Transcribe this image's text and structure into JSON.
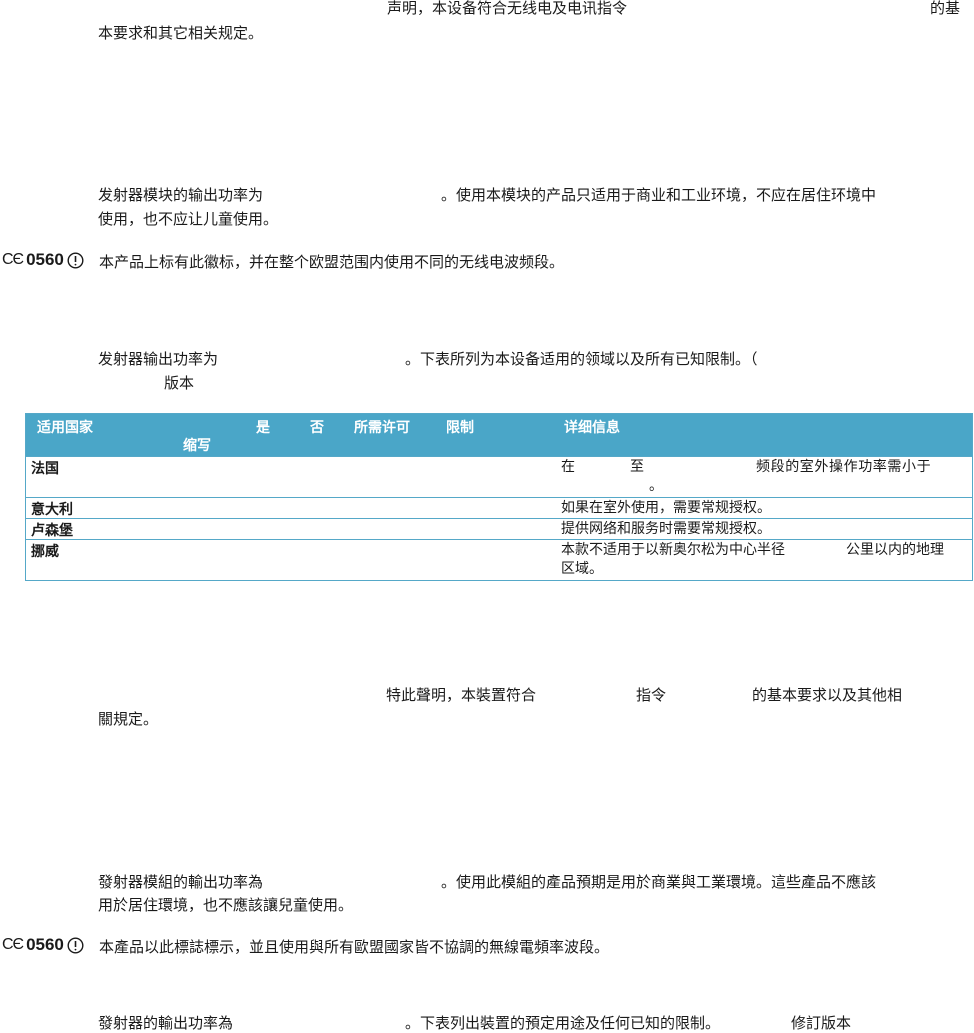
{
  "section_simplified": {
    "declaration_line1_a": "声明，本设备符合无线电及电讯指令",
    "declaration_line1_b": "的基",
    "declaration_line2": "本要求和其它相关规定。",
    "power_line1_a": "发射器模块的输出功率为",
    "power_line1_b": "。使用本模块的产品只适用于商业和工业环境，不应在居住环境中",
    "power_line2": "使用，也不应让儿童使用。",
    "ce_number": "0560",
    "ce_text": "本产品上标有此徽标，并在整个欧盟范围内使用不同的无线电波频段。",
    "table_intro_a": "发射器输出功率为",
    "table_intro_b": "。下表所列为本设备适用的领域以及所有已知限制。（",
    "table_intro_line2": "版本"
  },
  "table": {
    "header": {
      "country": "适用国家",
      "abbr": "缩写",
      "yes": "是",
      "no": "否",
      "license": "所需许可",
      "limit": "限制",
      "details": "详细信息"
    },
    "rows": [
      {
        "country": "法国",
        "info_line1_a": "在",
        "info_line1_b": "至",
        "info_line1_c": "频段的室外操作功率需小于",
        "info_line2": "。"
      },
      {
        "country": "意大利",
        "info_line1": "如果在室外使用，需要常规授权。"
      },
      {
        "country": "卢森堡",
        "info_line1": "提供网络和服务时需要常规授权。"
      },
      {
        "country": "挪威",
        "info_line1_a": "本款不适用于以新奥尔松为中心半径",
        "info_line1_b": "公里以内的地理",
        "info_line2": "区域。"
      }
    ]
  },
  "section_traditional": {
    "declaration_line1_a": "特此聲明，本裝置符合",
    "declaration_line1_b": "指令",
    "declaration_line1_c": "的基本要求以及其他相",
    "declaration_line2": "關規定。",
    "power_line1_a": "發射器模組的輸出功率為",
    "power_line1_b": "。使用此模組的產品預期是用於商業與工業環境。這些產品不應該",
    "power_line2": "用於居住環境，也不應該讓兒童使用。",
    "ce_number": "0560",
    "ce_text": "本產品以此標誌標示，並且使用與所有歐盟國家皆不協調的無線電頻率波段。",
    "table_intro_a": "發射器的輸出功率為",
    "table_intro_b": "。下表列出裝置的預定用途及任何已知的限制。",
    "table_intro_c": "修訂版本"
  },
  "icons": {
    "ce_mark": "CE",
    "alert": "alert-circle-icon"
  }
}
